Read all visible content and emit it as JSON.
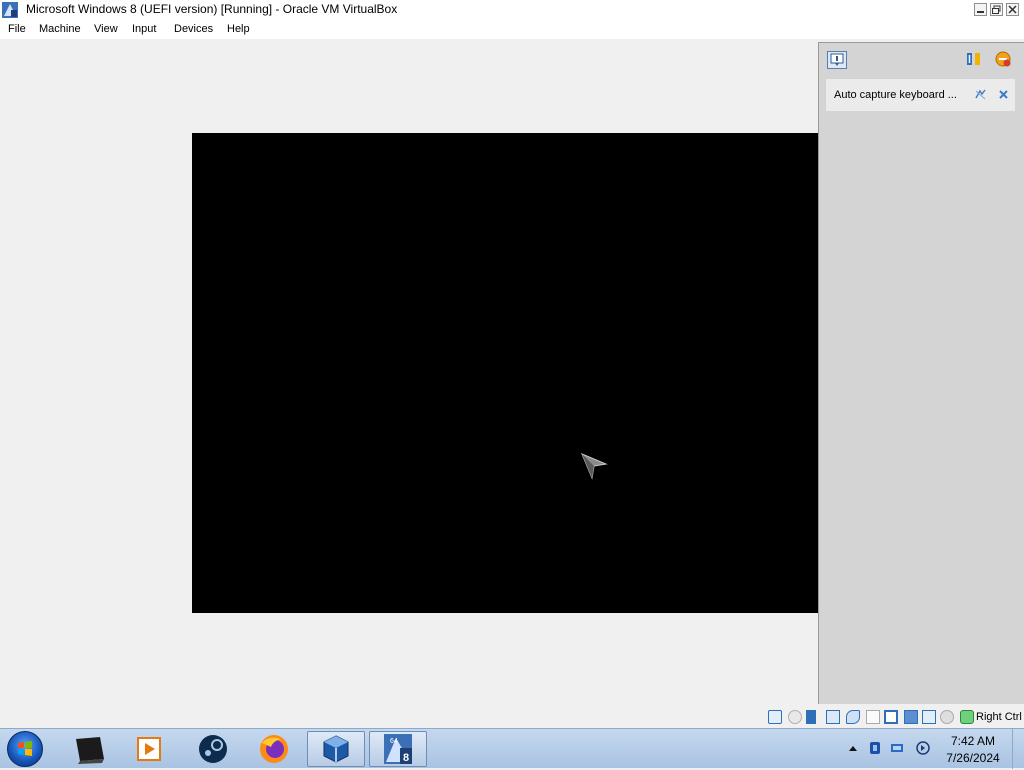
{
  "window": {
    "title": "Microsoft Windows 8 (UEFI version) [Running] - Oracle VM VirtualBox"
  },
  "menu": [
    "File",
    "Machine",
    "View",
    "Input",
    "Devices",
    "Help"
  ],
  "notification": {
    "text": "Auto capture keyboard ..."
  },
  "statusbar": {
    "host_key": "Right Ctrl"
  },
  "taskbar": {
    "apps": [
      "terminal-icon",
      "media-player-icon",
      "steam-icon",
      "firefox-icon",
      "virtualbox-icon",
      "windows8-vm-icon"
    ]
  },
  "clock": {
    "time": "7:42 AM",
    "date": "7/26/2024"
  },
  "colors": {
    "vm_screen": "#000000",
    "window_bg": "#f0f0f0",
    "taskbar": "#b8cfe9"
  }
}
